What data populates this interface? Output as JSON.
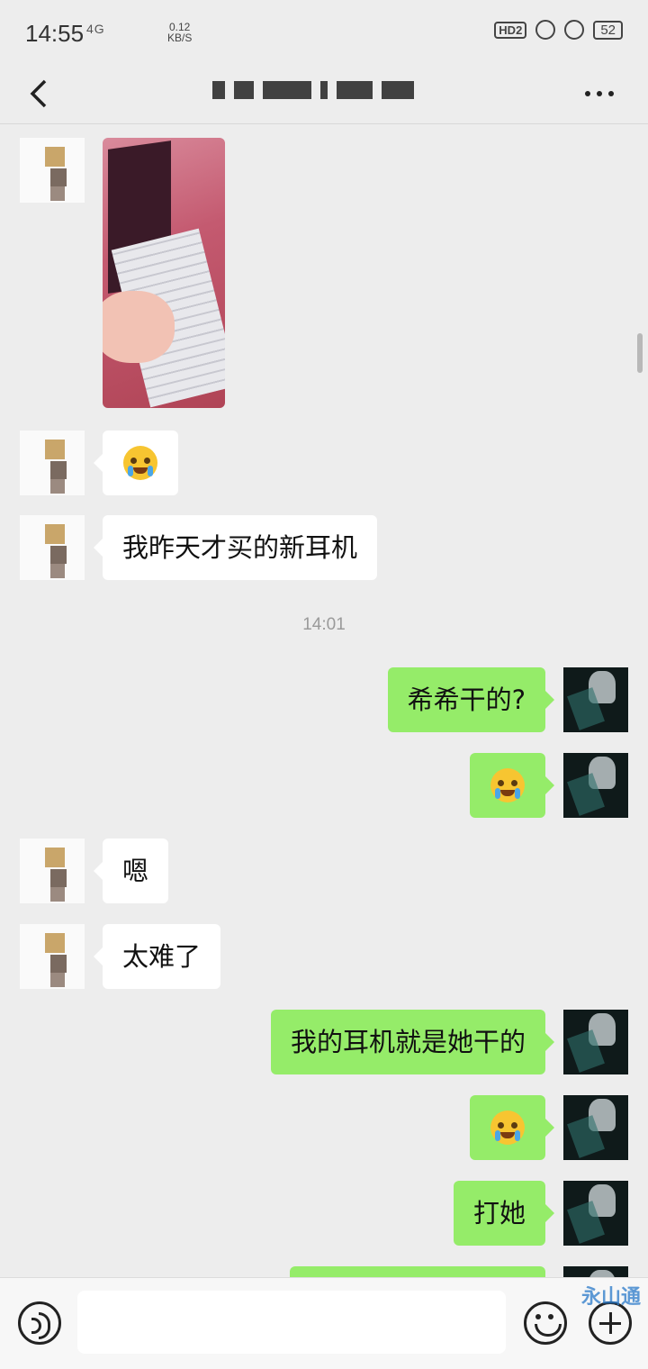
{
  "status_bar": {
    "time": "14:55",
    "network": "4G",
    "speed_value": "0.12",
    "speed_unit": "KB/S",
    "hd_label": "HD2",
    "battery": "52"
  },
  "nav": {
    "back_icon": "chevron-left-icon",
    "more_icon": "more-dots-icon"
  },
  "messages": [
    {
      "side": "in",
      "type": "image"
    },
    {
      "side": "in",
      "type": "emoji",
      "emoji": "crying-face"
    },
    {
      "side": "in",
      "type": "text",
      "text": "我昨天才买的新耳机"
    },
    {
      "side": "time",
      "text": "14:01"
    },
    {
      "side": "out",
      "type": "text",
      "text": "希希干的?"
    },
    {
      "side": "out",
      "type": "emoji",
      "emoji": "laughing-crying-face"
    },
    {
      "side": "in",
      "type": "text",
      "text": "嗯"
    },
    {
      "side": "in",
      "type": "text",
      "text": "太难了"
    },
    {
      "side": "out",
      "type": "text",
      "text": "我的耳机就是她干的"
    },
    {
      "side": "out",
      "type": "emoji",
      "emoji": "tears-of-joy-face"
    },
    {
      "side": "out",
      "type": "text",
      "text": "打她"
    }
  ],
  "input_bar": {
    "voice_icon": "voice-icon",
    "emoji_icon": "emoji-icon",
    "plus_icon": "plus-icon",
    "text_value": ""
  },
  "watermark": "永山通"
}
